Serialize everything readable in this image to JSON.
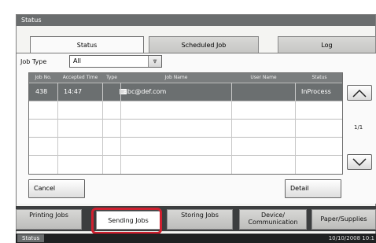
{
  "window": {
    "title": "Status"
  },
  "tabs": [
    {
      "label": "Status"
    },
    {
      "label": "Scheduled Job"
    },
    {
      "label": "Log"
    }
  ],
  "filter": {
    "label": "Job Type",
    "value": "All"
  },
  "table": {
    "columns": [
      "Job No.",
      "Accepted Time",
      "Type",
      "Job Name",
      "User Name",
      "Status"
    ],
    "rows": [
      {
        "job_no": "438",
        "accepted_time": "14:47",
        "type_icon": "email-icon",
        "job_name": "abc@def.com",
        "user_name": "",
        "status": "InProcess"
      }
    ],
    "empty_rows": 4
  },
  "pagination": {
    "indicator": "1/1"
  },
  "actions": {
    "cancel": "Cancel",
    "detail": "Detail"
  },
  "bottom_tabs": [
    {
      "label": "Printing Jobs"
    },
    {
      "label": "Sending Jobs",
      "selected": true
    },
    {
      "label": "Storing Jobs"
    },
    {
      "label_line1": "Device/",
      "label_line2": "Communication"
    },
    {
      "label": "Paper/Supplies"
    }
  ],
  "footer": {
    "status_label": "Status",
    "datetime": "10/10/2008  10:1"
  },
  "colors": {
    "highlight": "#d0202f",
    "selected_row": "#6b6f70",
    "header": "#7a7d7e"
  }
}
